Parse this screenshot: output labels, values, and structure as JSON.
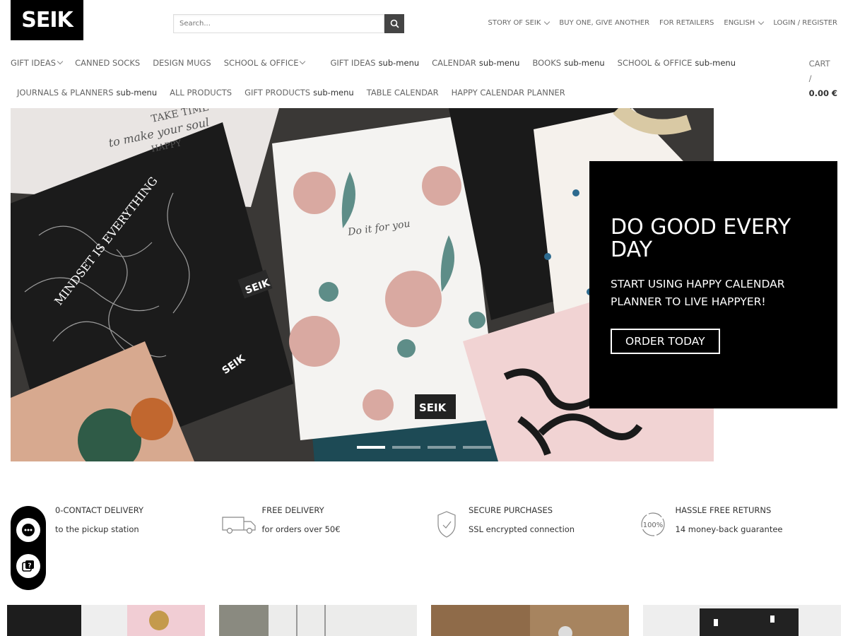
{
  "brand": {
    "logo": "SEIK"
  },
  "search": {
    "placeholder": "Search..."
  },
  "topnav": [
    {
      "label": "STORY OF SEIK",
      "dropdown": true
    },
    {
      "label": "BUY ONE, GIVE ANOTHER",
      "dropdown": false
    },
    {
      "label": "FOR RETAILERS",
      "dropdown": false
    },
    {
      "label": "ENGLISH",
      "dropdown": true
    },
    {
      "label": "LOGIN / REGISTER",
      "dropdown": false
    }
  ],
  "mainnav": {
    "row1": [
      {
        "label": "GIFT IDEAS",
        "sub": "",
        "dropdown": true
      },
      {
        "label": "CANNED SOCKS",
        "sub": "",
        "dropdown": false
      },
      {
        "label": "DESIGN MUGS",
        "sub": "",
        "dropdown": false
      },
      {
        "label": "SCHOOL & OFFICE",
        "sub": "",
        "dropdown": true
      },
      {
        "label": "GIFT IDEAS",
        "sub": "sub-menu",
        "dropdown": false
      },
      {
        "label": "CALENDAR",
        "sub": "sub-menu",
        "dropdown": false
      },
      {
        "label": "BOOKS",
        "sub": "sub-menu",
        "dropdown": false
      },
      {
        "label": "SCHOOL & OFFICE",
        "sub": "sub-menu",
        "dropdown": false
      }
    ],
    "row2": [
      {
        "label": "JOURNALS & PLANNERS",
        "sub": "sub-menu"
      },
      {
        "label": "ALL PRODUCTS",
        "sub": ""
      },
      {
        "label": "GIFT PRODUCTS",
        "sub": "sub-menu"
      },
      {
        "label": "TABLE CALENDAR",
        "sub": ""
      },
      {
        "label": "HAPPY CALENDAR PLANNER",
        "sub": ""
      }
    ]
  },
  "cart": {
    "label": "CART",
    "sep": "/",
    "amount": "0.00 €"
  },
  "hero": {
    "title": "DO GOOD EVERY DAY",
    "subtitle": "START USING HAPPY CALENDAR PLANNER TO LIVE HAPPYER!",
    "cta": "ORDER TODAY",
    "slides": 4,
    "active_slide": 1,
    "book_texts": [
      "TAKE TIME",
      "to make your soul",
      "HAPPY",
      "MINDSET IS EVERYTHING",
      "Do it for you",
      "SEIK"
    ]
  },
  "features": [
    {
      "icon": "location-icon",
      "title": "0-CONTACT DELIVERY",
      "text": "to the pickup station"
    },
    {
      "icon": "truck-icon",
      "title": "FREE DELIVERY",
      "text": "for orders over 50€"
    },
    {
      "icon": "shield-icon",
      "title": "SECURE PURCHASES",
      "text": "SSL encrypted connection"
    },
    {
      "icon": "hundred-percent-icon",
      "title": "HASSLE FREE RETURNS",
      "text": "14 money-back guarantee"
    }
  ],
  "colors": {
    "black": "#000000",
    "text": "#777777",
    "dark": "#333333"
  }
}
